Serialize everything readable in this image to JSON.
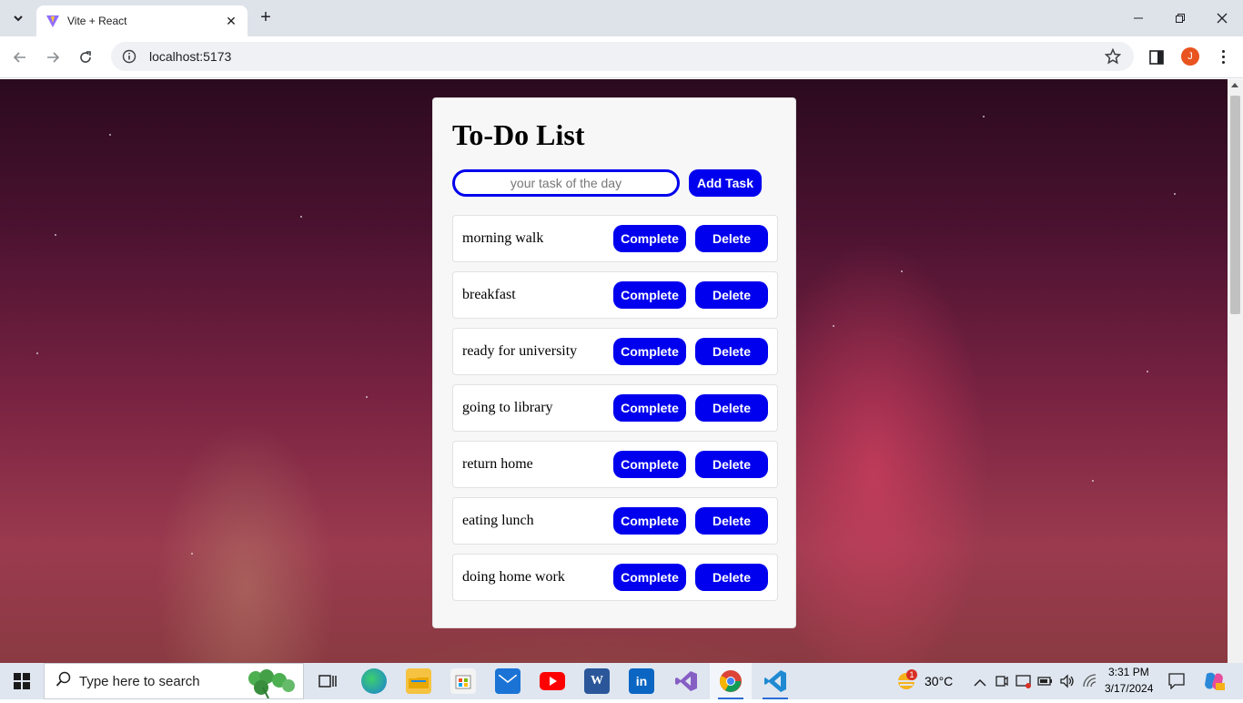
{
  "browser": {
    "tab_title": "Vite + React",
    "tab_close": "✕",
    "new_tab": "+",
    "url": "localhost:5173",
    "profile_initial": "J",
    "icons": [
      "tab-search-icon",
      "vite-favicon",
      "back-icon",
      "forward-icon",
      "reload-icon",
      "site-info-icon",
      "bookmark-star-icon",
      "side-panel-icon",
      "menu-icon",
      "minimize-icon",
      "maximize-icon",
      "close-icon"
    ]
  },
  "app": {
    "heading": "To-Do List",
    "input_placeholder": "your task of the day",
    "add_button": "Add Task",
    "complete_label": "Complete",
    "delete_label": "Delete",
    "tasks": [
      "morning walk",
      "breakfast",
      "ready for university",
      "going to library",
      "return home",
      "eating lunch",
      "doing home work"
    ],
    "accent_color": "#0000ee"
  },
  "taskbar": {
    "search_placeholder": "Type here to search",
    "weather_temp": "30°C",
    "weather_badge": "1",
    "time": "3:31 PM",
    "date": "3/17/2024",
    "apps": [
      "task-view-icon",
      "edge-icon",
      "file-explorer-icon",
      "store-icon",
      "mail-icon",
      "youtube-icon",
      "word-icon",
      "linkedin-icon",
      "visual-studio-icon",
      "chrome-icon",
      "vscode-icon"
    ]
  }
}
